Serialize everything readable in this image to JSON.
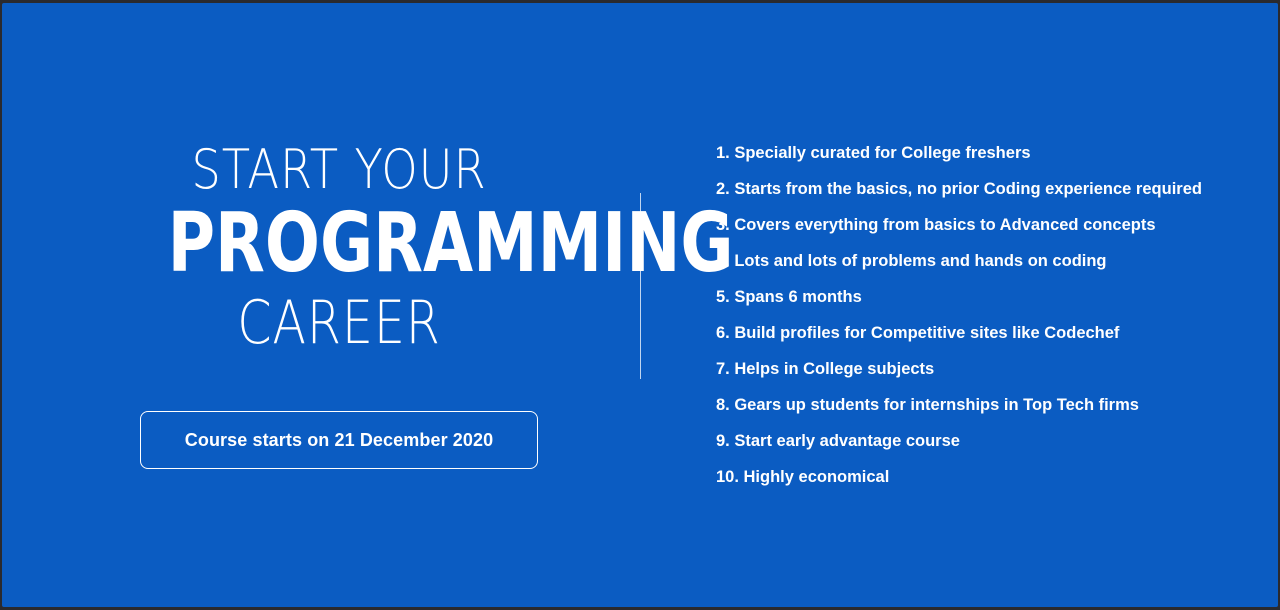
{
  "banner": {
    "headline": {
      "line1": "START YOUR",
      "line2": "PROGRAMMING",
      "line3": "CAREER"
    },
    "course_start": "Course starts on 21 December 2020",
    "features": [
      "1. Specially curated for College freshers",
      "2. Starts from the basics, no prior Coding experience required",
      "3. Covers everything from basics to Advanced concepts",
      "4. Lots and lots of problems and hands on coding",
      "5. Spans 6 months",
      "6. Build profiles for Competitive sites like Codechef",
      "7. Helps in College subjects",
      "8. Gears up students for internships in Top Tech firms",
      "9. Start early advantage course",
      "10. Highly economical"
    ],
    "colors": {
      "background": "#0b5cc2",
      "text": "#ffffff",
      "frame": "#2a2a2e"
    }
  }
}
